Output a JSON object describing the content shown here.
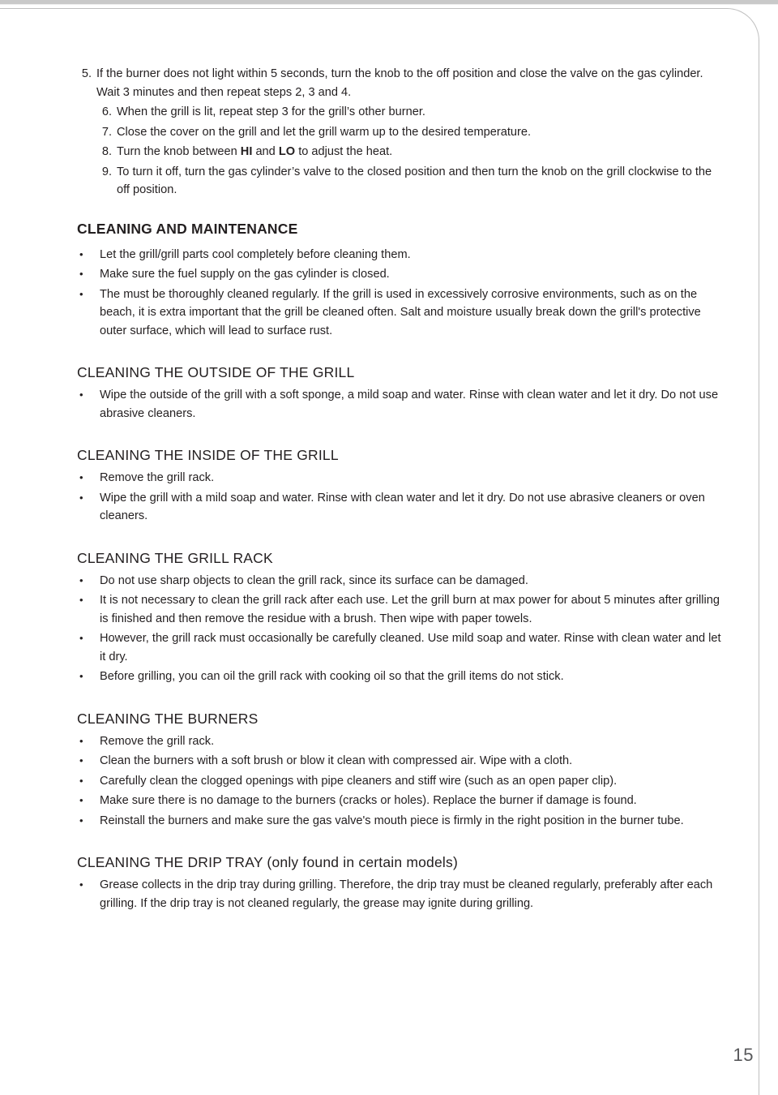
{
  "page": {
    "number": "15",
    "frame_color": "#bfbfbf",
    "top_bar_color": "#c9c9c9",
    "text_color": "#231f20"
  },
  "ordered_items": [
    {
      "num": "5.",
      "text": "If the burner does not light within 5 seconds, turn the knob to the off position and close the valve on the gas cylinder. Wait 3 minutes and then repeat steps 2, 3 and 4."
    },
    {
      "num": "6.",
      "text": "When the grill is lit, repeat step 3 for the grill’s other burner."
    },
    {
      "num": "7.",
      "text": "Close the cover on the grill and let the grill warm up to the desired temperature."
    },
    {
      "num": "8.",
      "text": "Turn the knob between HI and LO to adjust the heat.",
      "html": "Turn the knob between <b>HI</b> and <b>LO</b> to adjust the heat."
    },
    {
      "num": "9.",
      "text": "To turn it off, turn the gas cylinder’s valve to the closed position and then turn the knob on the grill clockwise to the off position."
    }
  ],
  "sections": [
    {
      "heading": "CLEANING AND MAINTENANCE",
      "heading_style": "main",
      "bullets": [
        "Let the grill/grill parts cool completely before cleaning them.",
        "Make sure the fuel supply on the gas cylinder is closed.",
        "The must be thoroughly cleaned regularly. If the grill is used in excessively corrosive environments, such as on the beach, it is extra important that the grill be cleaned often. Salt and moisture usually break down the grill's protective outer surface, which will lead to surface rust."
      ]
    },
    {
      "heading": "CLEANING THE OUTSIDE OF THE GRILL",
      "heading_style": "sub",
      "bullets": [
        "Wipe the outside of the grill with a soft sponge, a mild soap and water. Rinse with clean water and let it dry. Do not use abrasive cleaners."
      ]
    },
    {
      "heading": "CLEANING THE INSIDE OF THE GRILL",
      "heading_style": "sub",
      "bullets": [
        "Remove the grill rack.",
        "Wipe the grill with a mild soap and water. Rinse with clean water and let it dry. Do not use abrasive cleaners or oven cleaners."
      ]
    },
    {
      "heading": "CLEANING THE GRILL RACK",
      "heading_style": "sub",
      "bullets": [
        "Do not use sharp objects to clean the grill rack, since its surface can be damaged.",
        "It is not necessary to clean the grill rack after each use. Let the grill burn at max power for about 5 minutes after grilling is finished and then remove the residue with a brush. Then wipe with paper towels.",
        "However, the grill rack must occasionally be carefully cleaned. Use mild soap and water. Rinse with clean water and let it dry.",
        "Before grilling, you can oil the grill rack with cooking oil so that the grill items do not stick."
      ]
    },
    {
      "heading": "CLEANING THE BURNERS",
      "heading_style": "sub",
      "bullets": [
        "Remove the grill rack.",
        "Clean the burners with a soft brush or blow it clean with compressed air. Wipe with a cloth.",
        "Carefully clean the clogged openings with pipe cleaners and stiff wire (such as an open paper clip).",
        "Make sure there is no damage to the burners (cracks or holes). Replace the burner if damage is found.",
        "Reinstall the burners and make sure the gas valve's mouth piece is firmly in the right position in the burner tube."
      ]
    },
    {
      "heading": "CLEANING THE DRIP TRAY (only found in certain models)",
      "heading_style": "sub",
      "bullets": [
        "Grease collects in the drip tray during grilling. Therefore, the drip tray must be cleaned regularly, preferably after each grilling. If the drip tray is not cleaned regularly, the grease may ignite during grilling."
      ]
    }
  ],
  "bullet_glyph": "•"
}
